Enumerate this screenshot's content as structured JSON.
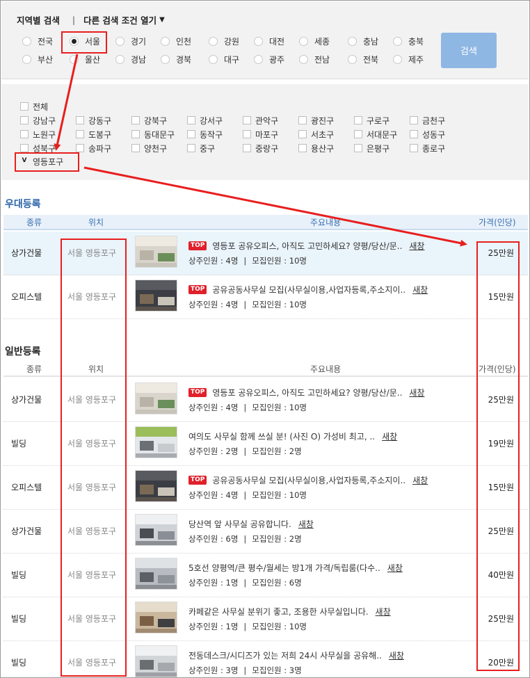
{
  "region_search": {
    "title": "지역별 검색",
    "separator": "|",
    "more_conditions": "다른 검색 조건 열기",
    "search_button": "검색",
    "regions": [
      "전국",
      "서울",
      "경기",
      "인천",
      "강원",
      "대전",
      "세종",
      "충남",
      "충북",
      "부산",
      "울산",
      "경남",
      "경북",
      "대구",
      "광주",
      "전남",
      "전북",
      "제주"
    ],
    "selected_region": "서울"
  },
  "districts": {
    "all_label": "전체",
    "items": [
      "강남구",
      "강동구",
      "강북구",
      "강서구",
      "관악구",
      "광진구",
      "구로구",
      "금천구",
      "노원구",
      "도봉구",
      "동대문구",
      "동작구",
      "마포구",
      "서초구",
      "서대문구",
      "성동구",
      "성북구",
      "송파구",
      "양천구",
      "중구",
      "중랑구",
      "용산구",
      "은평구",
      "종로구",
      "영등포구"
    ],
    "checked_mark": "V",
    "checked_district": "영등포구"
  },
  "premium": {
    "title": "우대등록",
    "columns": {
      "type": "종류",
      "location": "위치",
      "content": "주요내용",
      "price": "가격(인당)"
    },
    "rows": [
      {
        "type": "상가건물",
        "location": "서울 영등포구",
        "top": true,
        "title": "영등포 공유오피스, 아직도 고민하세요? 양평/당산/문..",
        "new": "새창",
        "info_resident": "상주인원 : 4명",
        "info_recruit": "모집인원 : 10명",
        "price": "25만원",
        "photo": "office-bright"
      },
      {
        "type": "오피스텔",
        "location": "서울 영등포구",
        "top": true,
        "title": "공유공동사무실 모집(사무실이용,사업자등록,주소지이..",
        "new": "새창",
        "info_resident": "상주인원 : 4명",
        "info_recruit": "모집인원 : 10명",
        "price": "15만원",
        "photo": "office-dark"
      }
    ]
  },
  "normal": {
    "title": "일반등록",
    "columns": {
      "type": "종류",
      "location": "위치",
      "content": "주요내용",
      "price": "가격(인당)"
    },
    "rows": [
      {
        "type": "상가건물",
        "location": "서울 영등포구",
        "top": true,
        "title": "영등포 공유오피스, 아직도 고민하세요? 양평/당산/문..",
        "new": "새창",
        "info_resident": "상주인원 : 4명",
        "info_recruit": "모집인원 : 10명",
        "price": "25만원",
        "photo": "office-bright"
      },
      {
        "type": "빌딩",
        "location": "서울 영등포구",
        "top": false,
        "title": "여의도 사무실 함께 쓰실 분! (사진 O) 가성비 최고, ..",
        "new": "새창",
        "info_resident": "상주인원 : 2명",
        "info_recruit": "모집인원 : 2명",
        "price": "19만원",
        "photo": "office-partition"
      },
      {
        "type": "오피스텔",
        "location": "서울 영등포구",
        "top": true,
        "title": "공유공동사무실 모집(사무실이용,사업자등록,주소지이..",
        "new": "새창",
        "info_resident": "상주인원 : 4명",
        "info_recruit": "모집인원 : 10명",
        "price": "15만원",
        "photo": "office-dark"
      },
      {
        "type": "상가건물",
        "location": "서울 영등포구",
        "top": false,
        "title": "당산역 앞 사무실 공유합니다.",
        "new": "새창",
        "info_resident": "상주인원 : 6명",
        "info_recruit": "모집인원 : 2명",
        "price": "25만원",
        "photo": "office-desks"
      },
      {
        "type": "빌딩",
        "location": "서울 영등포구",
        "top": false,
        "title": "5호선 양평역/큰 평수/월세는 방1개 가격/독립룸(다수..",
        "new": "새창",
        "info_resident": "상주인원 : 1명",
        "info_recruit": "모집인원 : 6명",
        "price": "40만원",
        "photo": "office-hall"
      },
      {
        "type": "빌딩",
        "location": "서울 영등포구",
        "top": false,
        "title": "카페같은 사무실 분위기 좋고, 조용한 사무실입니다.",
        "new": "새창",
        "info_resident": "상주인원 : 1명",
        "info_recruit": "모집인원 : 10명",
        "price": "25만원",
        "photo": "office-cafe"
      },
      {
        "type": "빌딩",
        "location": "서울 영등포구",
        "top": false,
        "title": "전동데스크/시디즈가 있는 저희 24시 사무실을 공유해..",
        "new": "새창",
        "info_resident": "상주인원 : 3명",
        "info_recruit": "모집인원 : 3명",
        "price": "20만원",
        "photo": "office-shelf"
      }
    ]
  },
  "colors": {
    "accent_blue": "#2a63a8",
    "search_button": "#8fb7e4",
    "annotation_red": "#e81e1e",
    "top_badge": "#e0202a",
    "panel_bg": "#f2f2f2",
    "highlight_row": "#eaf4fb"
  }
}
